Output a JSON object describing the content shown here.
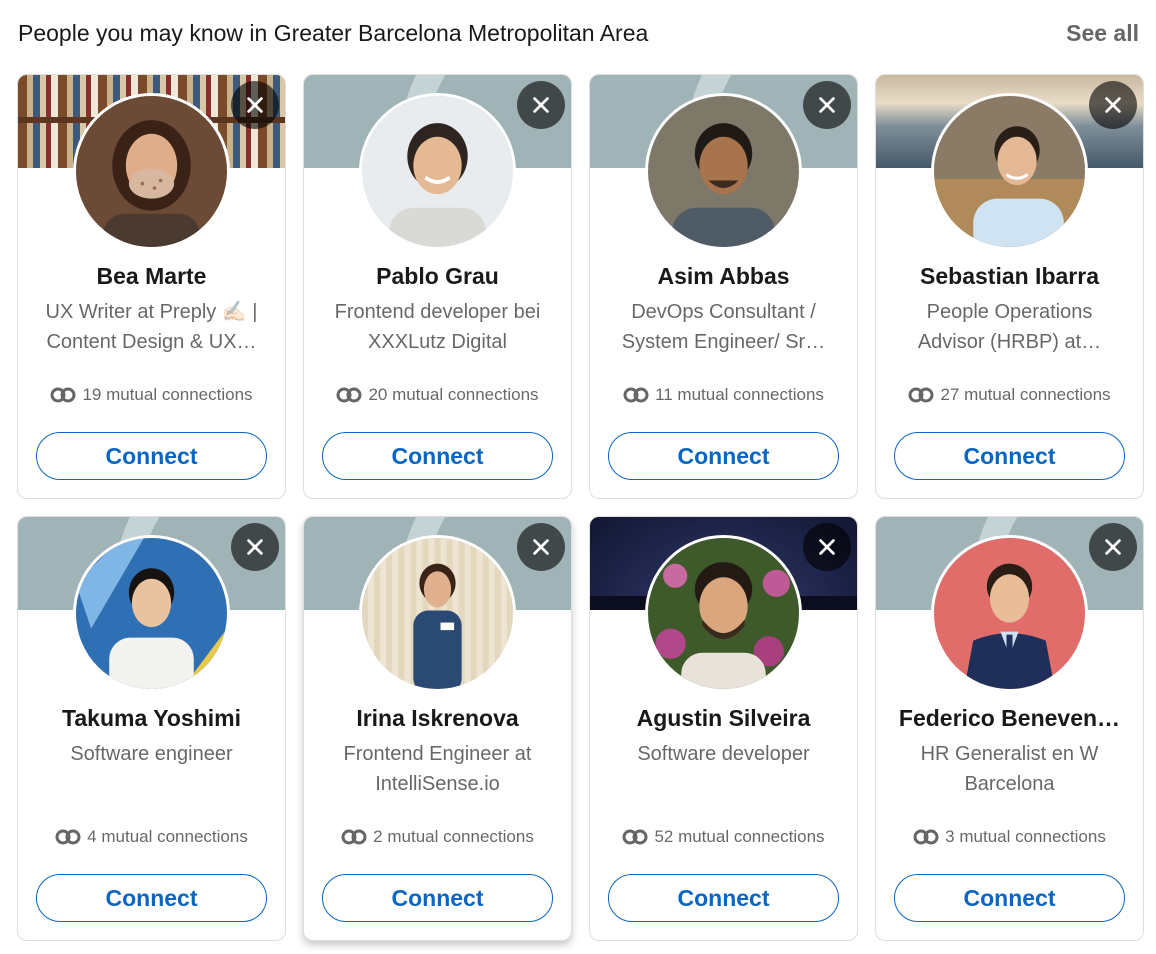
{
  "section": {
    "title": "People you may know in Greater Barcelona Metropolitan Area",
    "see_all": "See all"
  },
  "colors": {
    "accent": "#0a66c2",
    "text_primary": "rgba(0,0,0,0.9)",
    "text_secondary": "rgba(0,0,0,0.6)"
  },
  "people": [
    {
      "name": "Bea Marte",
      "headline": "UX Writer at Preply ✍🏻 | Content Design & UX…",
      "mutual": "19 mutual connections",
      "connect": "Connect",
      "banner": "books"
    },
    {
      "name": "Pablo Grau",
      "headline": "Frontend developer bei XXXLutz Digital",
      "mutual": "20 mutual connections",
      "connect": "Connect",
      "banner": "default"
    },
    {
      "name": "Asim Abbas",
      "headline": "DevOps Consultant / System Engineer/ Sr…",
      "mutual": "11 mutual connections",
      "connect": "Connect",
      "banner": "default"
    },
    {
      "name": "Sebastian Ibarra",
      "headline": "People Operations Advisor (HRBP) at…",
      "mutual": "27 mutual connections",
      "connect": "Connect",
      "banner": "sea"
    },
    {
      "name": "Takuma Yoshimi",
      "headline": "Software engineer",
      "mutual": "4 mutual connections",
      "connect": "Connect",
      "banner": "default"
    },
    {
      "name": "Irina Iskrenova",
      "headline": "Frontend Engineer at IntelliSense.io",
      "mutual": "2 mutual connections",
      "connect": "Connect",
      "banner": "default"
    },
    {
      "name": "Agustin Silveira",
      "headline": "Software developer",
      "mutual": "52 mutual connections",
      "connect": "Connect",
      "banner": "night"
    },
    {
      "name": "Federico Beneven…",
      "headline": "HR Generalist en W Barcelona",
      "mutual": "3 mutual connections",
      "connect": "Connect",
      "banner": "default"
    }
  ]
}
